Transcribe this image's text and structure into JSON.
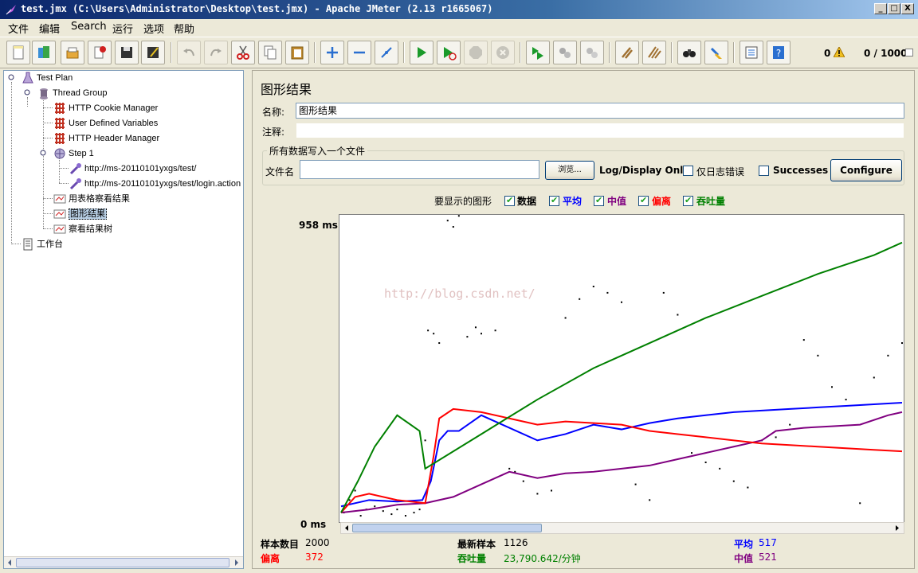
{
  "window": {
    "title": "test.jmx (C:\\Users\\Administrator\\Desktop\\test.jmx) - Apache JMeter (2.13 r1665067)",
    "minimize_glyph": "_",
    "maximize_glyph": "□",
    "close_glyph": "X"
  },
  "menu": [
    "文件",
    "编辑",
    "Search",
    "运行",
    "选项",
    "帮助"
  ],
  "toolbar": {
    "buttons": [
      "new-icon",
      "templates-icon",
      "open-icon",
      "close-icon",
      "save-icon",
      "save-as-icon",
      "undo-icon",
      "redo-icon",
      "cut-icon",
      "copy-icon",
      "paste-icon",
      "expand-icon",
      "collapse-icon",
      "toggle-icon",
      "start-icon",
      "start-no-pause-icon",
      "stop-icon",
      "shutdown-icon",
      "remote-start-icon",
      "remote-stop-icon",
      "remote-shutdown-icon",
      "clear-icon",
      "clear-all-icon",
      "search-icon",
      "reset-search-icon",
      "function-helper-icon",
      "help-icon"
    ],
    "error_count": "0",
    "thread_count": "0 / 1000"
  },
  "tree": [
    {
      "label": "Test Plan",
      "icon": "test-plan-icon",
      "level": 0
    },
    {
      "label": "Thread Group",
      "icon": "thread-group-icon",
      "level": 1
    },
    {
      "label": "HTTP Cookie Manager",
      "icon": "config-element-icon",
      "level": 2
    },
    {
      "label": "User Defined Variables",
      "icon": "config-element-icon",
      "level": 2
    },
    {
      "label": "HTTP Header Manager",
      "icon": "config-element-icon",
      "level": 2
    },
    {
      "label": "Step 1",
      "icon": "controller-icon",
      "level": 2
    },
    {
      "label": "http://ms-20110101yxgs/test/",
      "icon": "sampler-icon",
      "level": 3
    },
    {
      "label": "http://ms-20110101yxgs/test/login.action",
      "icon": "sampler-icon",
      "level": 3
    },
    {
      "label": "用表格察看结果",
      "icon": "listener-icon",
      "level": 2
    },
    {
      "label": "图形结果",
      "icon": "listener-icon",
      "level": 2,
      "selected": true
    },
    {
      "label": "察看结果树",
      "icon": "listener-icon",
      "level": 2
    },
    {
      "label": "工作台",
      "icon": "workbench-icon",
      "level": 0
    }
  ],
  "panel": {
    "title": "图形结果",
    "name_label": "名称:",
    "name_value": "图形结果",
    "comment_label": "注释:",
    "comment_value": "",
    "file_group_title": "所有数据写入一个文件",
    "filename_label": "文件名",
    "filename_value": "",
    "browse_label": "浏览...",
    "log_display_label": "Log/Display Only:",
    "errors_only_label": "仅日志错误",
    "successes_label": "Successes",
    "configure_label": "Configure",
    "graphs_to_display_label": "要显示的图形",
    "options": [
      {
        "label": "数据",
        "color": "#000000",
        "checked": true
      },
      {
        "label": "平均",
        "color": "#0000ff",
        "checked": true
      },
      {
        "label": "中值",
        "color": "#800080",
        "checked": true
      },
      {
        "label": "偏离",
        "color": "#ff0000",
        "checked": true
      },
      {
        "label": "吞吐量",
        "color": "#008000",
        "checked": true
      }
    ],
    "watermark": "http://blog.csdn.net/"
  },
  "chart_data": {
    "type": "line",
    "y_max_label": "958  ms",
    "y_min_label": "0  ms",
    "ylim": [
      0,
      958
    ],
    "xlim": [
      0,
      2000
    ],
    "series": [
      {
        "name": "数据",
        "color": "#000000",
        "style": "points",
        "points": [
          [
            10,
            20
          ],
          [
            30,
            60
          ],
          [
            50,
            90
          ],
          [
            70,
            10
          ],
          [
            90,
            30
          ],
          [
            120,
            40
          ],
          [
            150,
            25
          ],
          [
            180,
            15
          ],
          [
            200,
            30
          ],
          [
            230,
            10
          ],
          [
            260,
            20
          ],
          [
            280,
            30
          ],
          [
            300,
            250
          ],
          [
            310,
            600
          ],
          [
            330,
            590
          ],
          [
            350,
            560
          ],
          [
            380,
            950
          ],
          [
            400,
            930
          ],
          [
            420,
            965
          ],
          [
            450,
            580
          ],
          [
            480,
            610
          ],
          [
            500,
            590
          ],
          [
            550,
            600
          ],
          [
            600,
            160
          ],
          [
            620,
            150
          ],
          [
            650,
            120
          ],
          [
            700,
            80
          ],
          [
            750,
            90
          ],
          [
            800,
            640
          ],
          [
            850,
            700
          ],
          [
            900,
            740
          ],
          [
            950,
            720
          ],
          [
            1000,
            690
          ],
          [
            1050,
            110
          ],
          [
            1100,
            60
          ],
          [
            1150,
            720
          ],
          [
            1200,
            650
          ],
          [
            1250,
            210
          ],
          [
            1300,
            180
          ],
          [
            1350,
            160
          ],
          [
            1400,
            120
          ],
          [
            1450,
            100
          ],
          [
            1500,
            250
          ],
          [
            1550,
            260
          ],
          [
            1600,
            300
          ],
          [
            1650,
            570
          ],
          [
            1700,
            520
          ],
          [
            1750,
            420
          ],
          [
            1800,
            380
          ],
          [
            1850,
            50
          ],
          [
            1900,
            450
          ],
          [
            1950,
            520
          ],
          [
            2000,
            560
          ]
        ]
      },
      {
        "name": "平均",
        "color": "#0000ff",
        "style": "line",
        "points": [
          [
            0,
            40
          ],
          [
            100,
            60
          ],
          [
            200,
            55
          ],
          [
            290,
            60
          ],
          [
            320,
            120
          ],
          [
            350,
            250
          ],
          [
            380,
            280
          ],
          [
            420,
            280
          ],
          [
            500,
            330
          ],
          [
            550,
            310
          ],
          [
            600,
            290
          ],
          [
            700,
            250
          ],
          [
            800,
            270
          ],
          [
            900,
            300
          ],
          [
            1000,
            285
          ],
          [
            1100,
            305
          ],
          [
            1200,
            320
          ],
          [
            1300,
            330
          ],
          [
            1400,
            340
          ],
          [
            1500,
            345
          ],
          [
            1600,
            350
          ],
          [
            1700,
            355
          ],
          [
            1800,
            360
          ],
          [
            1900,
            365
          ],
          [
            2000,
            370
          ]
        ]
      },
      {
        "name": "中值",
        "color": "#800080",
        "style": "line",
        "points": [
          [
            0,
            20
          ],
          [
            100,
            30
          ],
          [
            200,
            45
          ],
          [
            300,
            50
          ],
          [
            400,
            70
          ],
          [
            500,
            110
          ],
          [
            600,
            150
          ],
          [
            700,
            130
          ],
          [
            800,
            145
          ],
          [
            900,
            150
          ],
          [
            1000,
            160
          ],
          [
            1100,
            170
          ],
          [
            1200,
            190
          ],
          [
            1300,
            210
          ],
          [
            1400,
            230
          ],
          [
            1500,
            250
          ],
          [
            1550,
            280
          ],
          [
            1650,
            290
          ],
          [
            1750,
            295
          ],
          [
            1850,
            300
          ],
          [
            1950,
            330
          ],
          [
            2000,
            340
          ]
        ]
      },
      {
        "name": "偏离",
        "color": "#ff0000",
        "style": "line",
        "points": [
          [
            0,
            20
          ],
          [
            50,
            70
          ],
          [
            100,
            80
          ],
          [
            200,
            60
          ],
          [
            300,
            50
          ],
          [
            330,
            200
          ],
          [
            350,
            320
          ],
          [
            400,
            350
          ],
          [
            500,
            340
          ],
          [
            600,
            320
          ],
          [
            700,
            300
          ],
          [
            800,
            310
          ],
          [
            900,
            305
          ],
          [
            1000,
            300
          ],
          [
            1100,
            280
          ],
          [
            1200,
            270
          ],
          [
            1300,
            260
          ],
          [
            1400,
            250
          ],
          [
            1500,
            240
          ],
          [
            1600,
            235
          ],
          [
            1700,
            230
          ],
          [
            1800,
            225
          ],
          [
            1900,
            220
          ],
          [
            2000,
            215
          ]
        ]
      },
      {
        "name": "吞吐量",
        "color": "#008000",
        "style": "line",
        "points": [
          [
            0,
            20
          ],
          [
            60,
            120
          ],
          [
            120,
            230
          ],
          [
            200,
            330
          ],
          [
            280,
            280
          ],
          [
            300,
            160
          ],
          [
            500,
            270
          ],
          [
            700,
            380
          ],
          [
            900,
            480
          ],
          [
            1100,
            560
          ],
          [
            1300,
            640
          ],
          [
            1500,
            710
          ],
          [
            1700,
            780
          ],
          [
            1900,
            840
          ],
          [
            2000,
            880
          ]
        ]
      }
    ]
  },
  "stats": {
    "sample_count_label": "样本数目",
    "sample_count": "2000",
    "latest_sample_label": "最新样本",
    "latest_sample": "1126",
    "average_label": "平均",
    "average": "517",
    "deviation_label": "偏离",
    "deviation": "372",
    "throughput_label": "吞吐量",
    "throughput": "23,790.642/分钟",
    "median_label": "中值",
    "median": "521"
  },
  "colors": {
    "deviation": "#ff0000",
    "throughput": "#008000",
    "average": "#0000ff",
    "median": "#800080"
  }
}
